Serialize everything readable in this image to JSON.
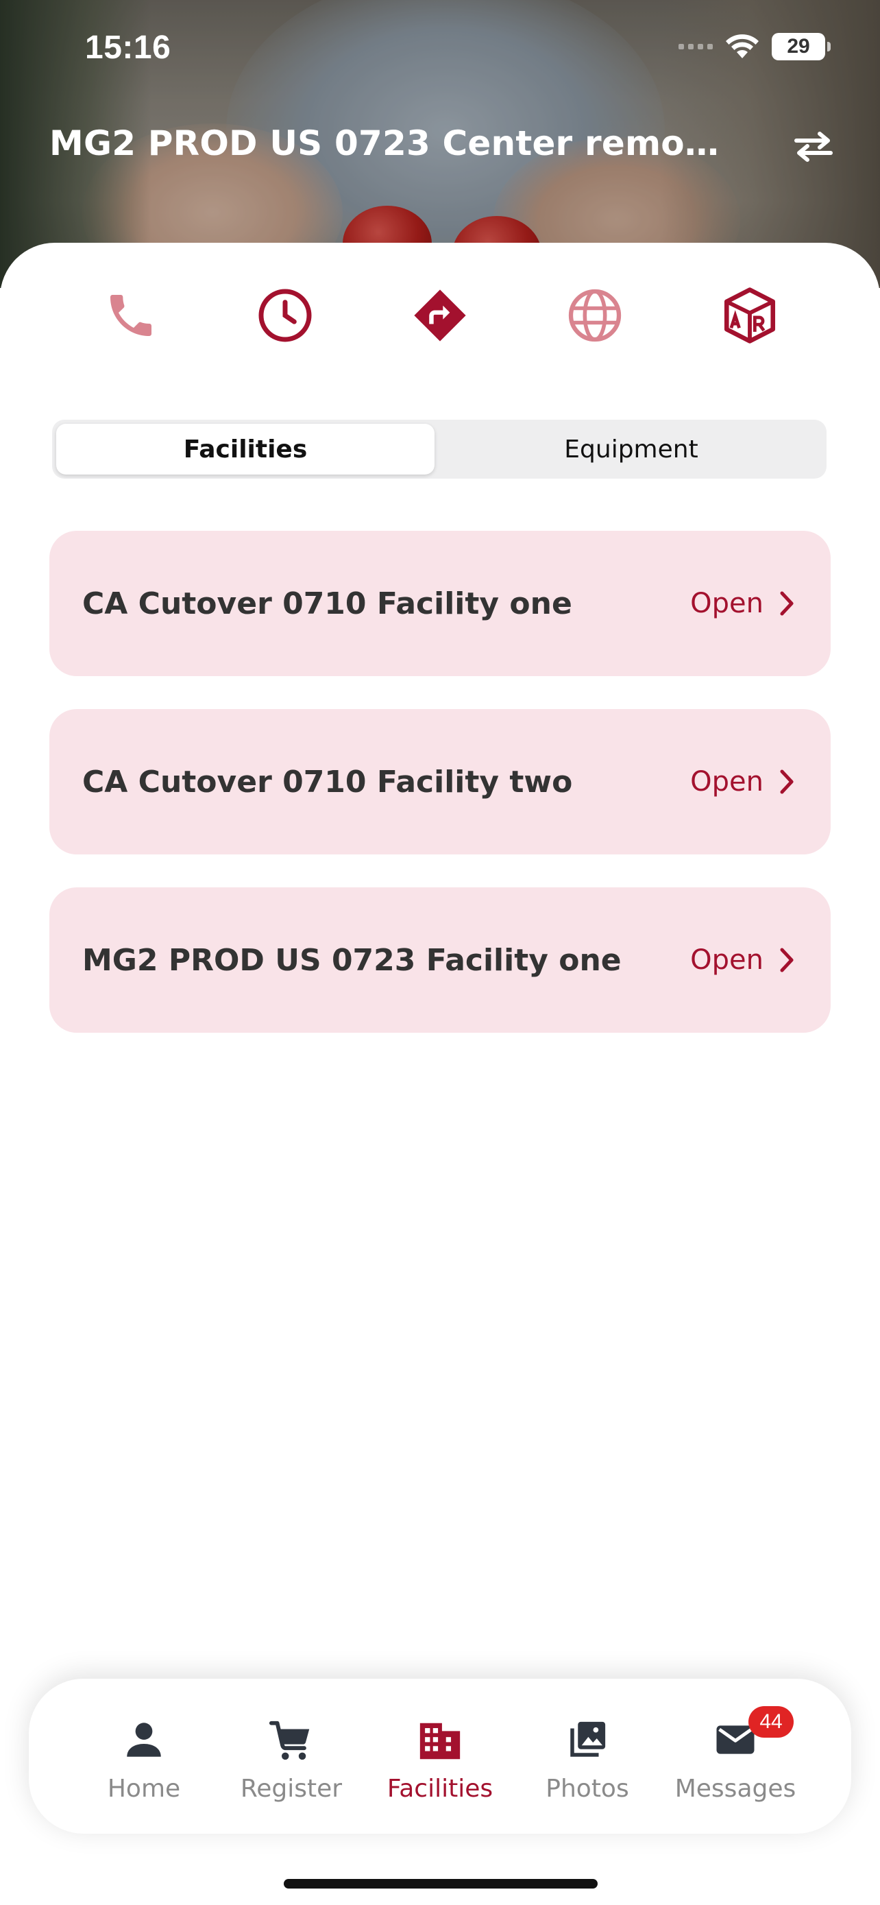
{
  "status_bar": {
    "time": "15:16",
    "battery_level": "29"
  },
  "header": {
    "title": "MG2 PROD US 0723 Center remove…",
    "switch_icon": "swap-arrows-icon"
  },
  "quick_actions": [
    {
      "icon": "phone-icon",
      "color": "#d9848f"
    },
    {
      "icon": "clock-icon",
      "color": "#a3112e"
    },
    {
      "icon": "directions-icon",
      "color": "#a3112e"
    },
    {
      "icon": "globe-icon",
      "color": "#d9848f"
    },
    {
      "icon": "ar-cube-icon",
      "color": "#a3112e"
    }
  ],
  "segmented": {
    "active": "Facilities",
    "inactive": "Equipment"
  },
  "facilities": [
    {
      "name": "CA Cutover 0710 Facility one",
      "status": "Open"
    },
    {
      "name": "CA Cutover 0710 Facility two",
      "status": "Open"
    },
    {
      "name": "MG2 PROD US 0723 Facility one",
      "status": "Open"
    }
  ],
  "tabbar": {
    "tabs": [
      {
        "label": "Home",
        "icon": "person-icon"
      },
      {
        "label": "Register",
        "icon": "cart-icon"
      },
      {
        "label": "Facilities",
        "icon": "building-icon"
      },
      {
        "label": "Photos",
        "icon": "photos-icon"
      },
      {
        "label": "Messages",
        "icon": "mail-icon",
        "badge": "44"
      }
    ],
    "active": "Facilities"
  },
  "colors": {
    "accent": "#a3112e",
    "accent_light": "#d9848f",
    "card_bg": "#f9e3e8",
    "badge": "#e02424"
  }
}
